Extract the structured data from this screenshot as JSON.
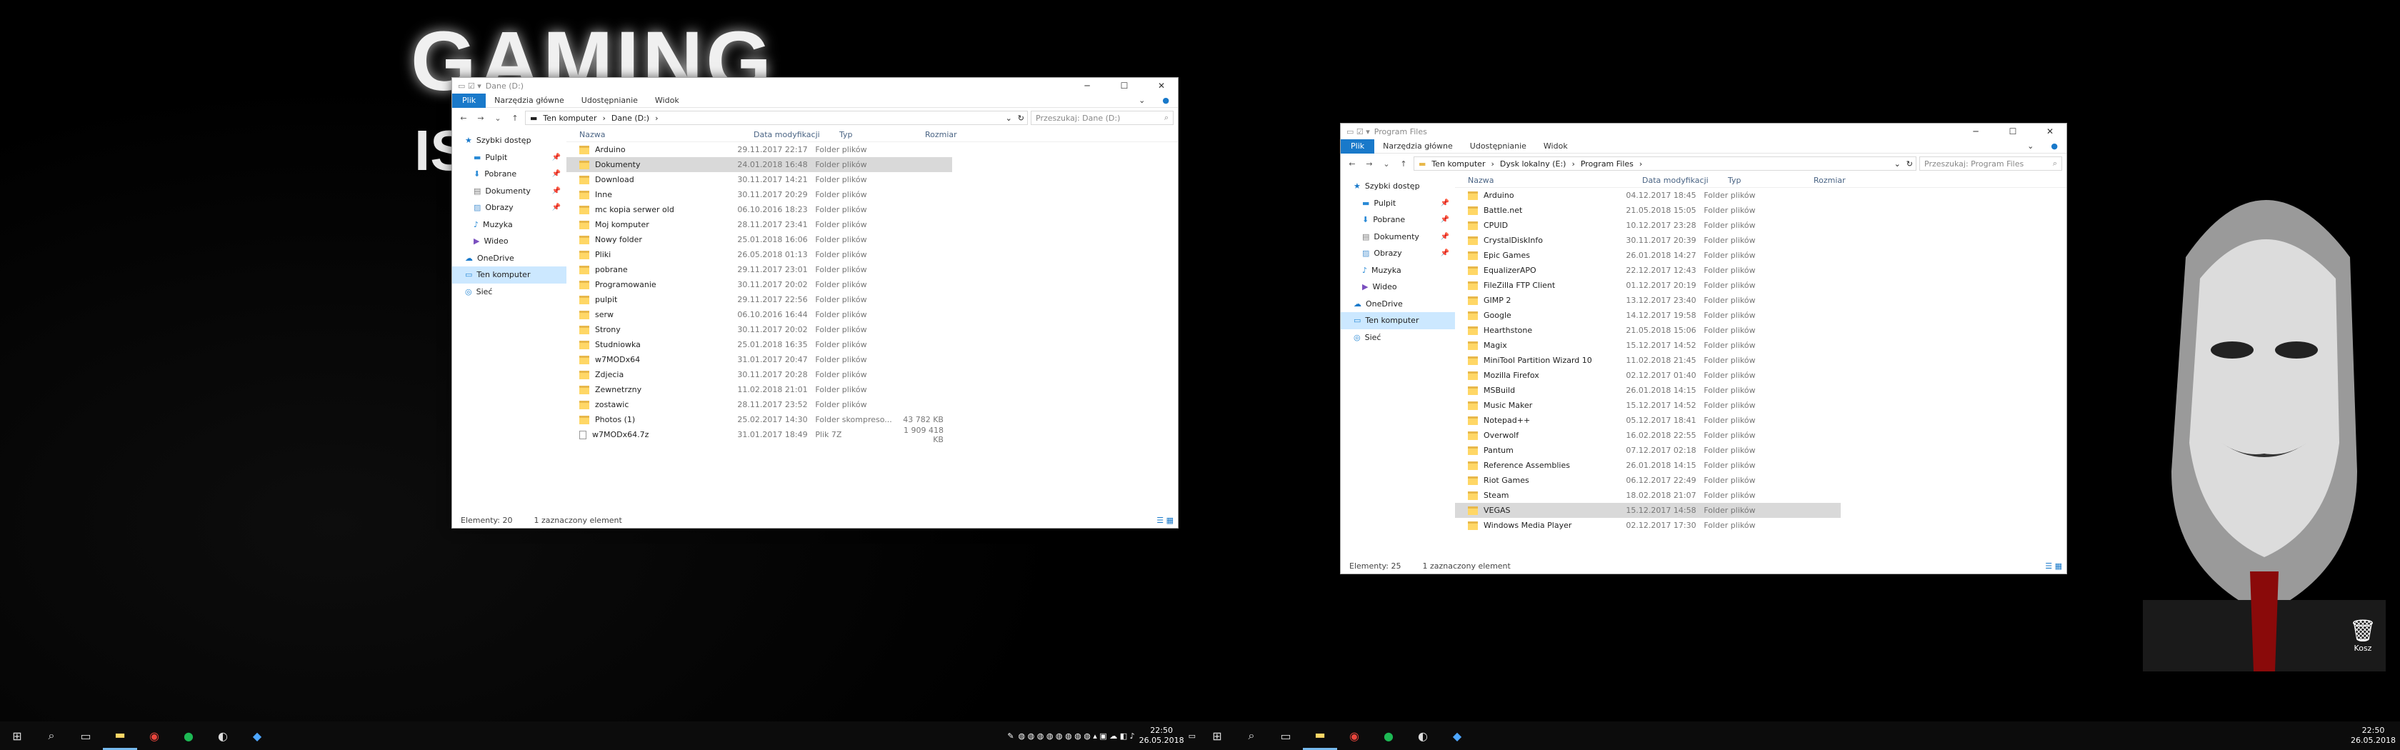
{
  "wallpaper": {
    "title": "GAMING",
    "subtitle": "IS"
  },
  "desktop": {
    "recycle_bin": "Kosz"
  },
  "win1": {
    "title": "Dane (D:)",
    "tabs": {
      "file": "Plik",
      "home": "Narzędzia główne",
      "share": "Udostępnianie",
      "view": "Widok"
    },
    "address": [
      "Ten komputer",
      "Dane (D:)"
    ],
    "search_placeholder": "Przeszukaj: Dane (D:)",
    "columns": {
      "name": "Nazwa",
      "date": "Data modyfikacji",
      "type": "Typ",
      "size": "Rozmiar"
    },
    "sidebar": [
      {
        "label": "Szybki dostęp",
        "cls": "",
        "icon": "star"
      },
      {
        "label": "Pulpit",
        "cls": "sub",
        "icon": "desk",
        "pin": true
      },
      {
        "label": "Pobrane",
        "cls": "sub",
        "icon": "down",
        "pin": true
      },
      {
        "label": "Dokumenty",
        "cls": "sub",
        "icon": "doc",
        "pin": true
      },
      {
        "label": "Obrazy",
        "cls": "sub",
        "icon": "pic",
        "pin": true
      },
      {
        "label": "Muzyka",
        "cls": "sub",
        "icon": "music"
      },
      {
        "label": "Wideo",
        "cls": "sub",
        "icon": "video"
      },
      {
        "label": "OneDrive",
        "cls": "",
        "icon": "cloud"
      },
      {
        "label": "Ten komputer",
        "cls": "sel",
        "icon": "pc"
      },
      {
        "label": "Sieć",
        "cls": "",
        "icon": "net"
      }
    ],
    "rows": [
      {
        "name": "Arduino",
        "date": "29.11.2017 22:17",
        "type": "Folder plików",
        "size": ""
      },
      {
        "name": "Dokumenty",
        "date": "24.01.2018 16:48",
        "type": "Folder plików",
        "size": "",
        "sel": true
      },
      {
        "name": "Download",
        "date": "30.11.2017 14:21",
        "type": "Folder plików",
        "size": ""
      },
      {
        "name": "Inne",
        "date": "30.11.2017 20:29",
        "type": "Folder plików",
        "size": ""
      },
      {
        "name": "mc kopia serwer old",
        "date": "06.10.2016 18:23",
        "type": "Folder plików",
        "size": ""
      },
      {
        "name": "Moj komputer",
        "date": "28.11.2017 23:41",
        "type": "Folder plików",
        "size": ""
      },
      {
        "name": "Nowy folder",
        "date": "25.01.2018 16:06",
        "type": "Folder plików",
        "size": ""
      },
      {
        "name": "Pliki",
        "date": "26.05.2018 01:13",
        "type": "Folder plików",
        "size": ""
      },
      {
        "name": "pobrane",
        "date": "29.11.2017 23:01",
        "type": "Folder plików",
        "size": ""
      },
      {
        "name": "Programowanie",
        "date": "30.11.2017 20:02",
        "type": "Folder plików",
        "size": ""
      },
      {
        "name": "pulpit",
        "date": "29.11.2017 22:56",
        "type": "Folder plików",
        "size": ""
      },
      {
        "name": "serw",
        "date": "06.10.2016 16:44",
        "type": "Folder plików",
        "size": ""
      },
      {
        "name": "Strony",
        "date": "30.11.2017 20:02",
        "type": "Folder plików",
        "size": ""
      },
      {
        "name": "Studniowka",
        "date": "25.01.2018 16:35",
        "type": "Folder plików",
        "size": ""
      },
      {
        "name": "w7MODx64",
        "date": "31.01.2017 20:47",
        "type": "Folder plików",
        "size": ""
      },
      {
        "name": "Zdjecia",
        "date": "30.11.2017 20:28",
        "type": "Folder plików",
        "size": ""
      },
      {
        "name": "Zewnetrzny",
        "date": "11.02.2018 21:01",
        "type": "Folder plików",
        "size": ""
      },
      {
        "name": "zostawic",
        "date": "28.11.2017 23:52",
        "type": "Folder plików",
        "size": ""
      },
      {
        "name": "Photos (1)",
        "date": "25.02.2017 14:30",
        "type": "Folder skompreso...",
        "size": "43 782 KB"
      },
      {
        "name": "w7MODx64.7z",
        "date": "31.01.2017 18:49",
        "type": "Plik 7Z",
        "size": "1 909 418 KB",
        "file": true
      }
    ],
    "status_count": "Elementy: 20",
    "status_sel": "1 zaznaczony element"
  },
  "win2": {
    "title": "Program Files",
    "tabs": {
      "file": "Plik",
      "home": "Narzędzia główne",
      "share": "Udostępnianie",
      "view": "Widok"
    },
    "address": [
      "Ten komputer",
      "Dysk lokalny (E:)",
      "Program Files"
    ],
    "search_placeholder": "Przeszukaj: Program Files",
    "columns": {
      "name": "Nazwa",
      "date": "Data modyfikacji",
      "type": "Typ",
      "size": "Rozmiar"
    },
    "sidebar": [
      {
        "label": "Szybki dostęp",
        "cls": "",
        "icon": "star"
      },
      {
        "label": "Pulpit",
        "cls": "sub",
        "icon": "desk",
        "pin": true
      },
      {
        "label": "Pobrane",
        "cls": "sub",
        "icon": "down",
        "pin": true
      },
      {
        "label": "Dokumenty",
        "cls": "sub",
        "icon": "doc",
        "pin": true
      },
      {
        "label": "Obrazy",
        "cls": "sub",
        "icon": "pic",
        "pin": true
      },
      {
        "label": "Muzyka",
        "cls": "sub",
        "icon": "music"
      },
      {
        "label": "Wideo",
        "cls": "sub",
        "icon": "video"
      },
      {
        "label": "OneDrive",
        "cls": "",
        "icon": "cloud"
      },
      {
        "label": "Ten komputer",
        "cls": "sel",
        "icon": "pc"
      },
      {
        "label": "Sieć",
        "cls": "",
        "icon": "net"
      }
    ],
    "rows": [
      {
        "name": "Arduino",
        "date": "04.12.2017 18:45",
        "type": "Folder plików",
        "size": ""
      },
      {
        "name": "Battle.net",
        "date": "21.05.2018 15:05",
        "type": "Folder plików",
        "size": ""
      },
      {
        "name": "CPUID",
        "date": "10.12.2017 23:28",
        "type": "Folder plików",
        "size": ""
      },
      {
        "name": "CrystalDiskInfo",
        "date": "30.11.2017 20:39",
        "type": "Folder plików",
        "size": ""
      },
      {
        "name": "Epic Games",
        "date": "26.01.2018 14:27",
        "type": "Folder plików",
        "size": ""
      },
      {
        "name": "EqualizerAPO",
        "date": "22.12.2017 12:43",
        "type": "Folder plików",
        "size": ""
      },
      {
        "name": "FileZilla FTP Client",
        "date": "01.12.2017 20:19",
        "type": "Folder plików",
        "size": ""
      },
      {
        "name": "GIMP 2",
        "date": "13.12.2017 23:40",
        "type": "Folder plików",
        "size": ""
      },
      {
        "name": "Google",
        "date": "14.12.2017 19:58",
        "type": "Folder plików",
        "size": ""
      },
      {
        "name": "Hearthstone",
        "date": "21.05.2018 15:06",
        "type": "Folder plików",
        "size": ""
      },
      {
        "name": "Magix",
        "date": "15.12.2017 14:52",
        "type": "Folder plików",
        "size": ""
      },
      {
        "name": "MiniTool Partition Wizard 10",
        "date": "11.02.2018 21:45",
        "type": "Folder plików",
        "size": ""
      },
      {
        "name": "Mozilla Firefox",
        "date": "02.12.2017 01:40",
        "type": "Folder plików",
        "size": ""
      },
      {
        "name": "MSBuild",
        "date": "26.01.2018 14:15",
        "type": "Folder plików",
        "size": ""
      },
      {
        "name": "Music Maker",
        "date": "15.12.2017 14:52",
        "type": "Folder plików",
        "size": ""
      },
      {
        "name": "Notepad++",
        "date": "05.12.2017 18:41",
        "type": "Folder plików",
        "size": ""
      },
      {
        "name": "Overwolf",
        "date": "16.02.2018 22:55",
        "type": "Folder plików",
        "size": ""
      },
      {
        "name": "Pantum",
        "date": "07.12.2017 02:18",
        "type": "Folder plików",
        "size": ""
      },
      {
        "name": "Reference Assemblies",
        "date": "26.01.2018 14:15",
        "type": "Folder plików",
        "size": ""
      },
      {
        "name": "Riot Games",
        "date": "06.12.2017 22:49",
        "type": "Folder plików",
        "size": ""
      },
      {
        "name": "Steam",
        "date": "18.02.2018 21:07",
        "type": "Folder plików",
        "size": ""
      },
      {
        "name": "VEGAS",
        "date": "15.12.2017 14:58",
        "type": "Folder plików",
        "size": "",
        "sel": true
      },
      {
        "name": "Windows Media Player",
        "date": "02.12.2017 17:30",
        "type": "Folder plików",
        "size": ""
      }
    ],
    "status_count": "Elementy: 25",
    "status_sel": "1 zaznaczony element"
  },
  "taskbar": {
    "time": "22:50",
    "date": "26.05.2018"
  }
}
